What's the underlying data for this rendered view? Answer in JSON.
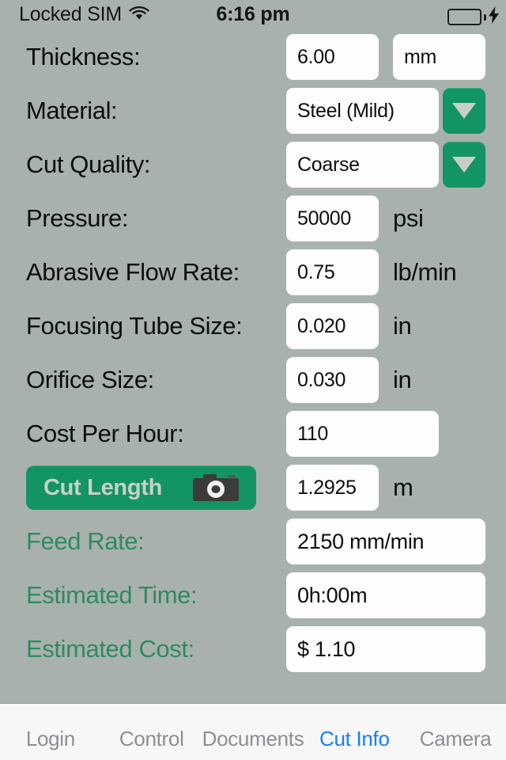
{
  "statusbar": {
    "carrier": "Locked SIM",
    "wifi_icon": "wifi-icon",
    "time": "6:16 pm",
    "battery_icon": "battery-full-icon",
    "charging_icon": "charging-bolt-icon",
    "battery_color": "#4cd964"
  },
  "theme": {
    "background": "#a9b1ae",
    "accent_green": "#129466",
    "result_label_green": "#2e8b60",
    "active_tab_blue": "#157efb",
    "field_background": "#fdfdfd"
  },
  "form": {
    "rows": [
      {
        "label": "Thickness:",
        "value": "6.00",
        "unit": "mm",
        "unit_in_box": true
      },
      {
        "label": "Material:",
        "value": "Steel (Mild)",
        "dropdown": true
      },
      {
        "label": "Cut Quality:",
        "value": "Coarse",
        "dropdown": true
      },
      {
        "label": "Pressure:",
        "value": "50000",
        "unit": "psi"
      },
      {
        "label": "Abrasive Flow Rate:",
        "value": "0.75",
        "unit": "lb/min"
      },
      {
        "label": "Focusing Tube Size:",
        "value": "0.020",
        "unit": "in"
      },
      {
        "label": "Orifice Size:",
        "value": "0.030",
        "unit": "in"
      },
      {
        "label": "Cost Per Hour:",
        "value": "110"
      }
    ]
  },
  "cut_length": {
    "button_label": "Cut Length",
    "camera_icon": "camera-icon",
    "value": "1.2925",
    "unit": "m"
  },
  "results": {
    "rows": [
      {
        "label": "Feed Rate:",
        "value": "2150 mm/min"
      },
      {
        "label": "Estimated Time:",
        "value": "0h:00m"
      },
      {
        "label": "Estimated Cost:",
        "value": "$ 1.10"
      }
    ]
  },
  "tabbar": {
    "tabs": [
      {
        "label": "Login",
        "active": false
      },
      {
        "label": "Control",
        "active": false
      },
      {
        "label": "Documents",
        "active": false
      },
      {
        "label": "Cut Info",
        "active": true
      },
      {
        "label": "Camera",
        "active": false
      }
    ]
  }
}
